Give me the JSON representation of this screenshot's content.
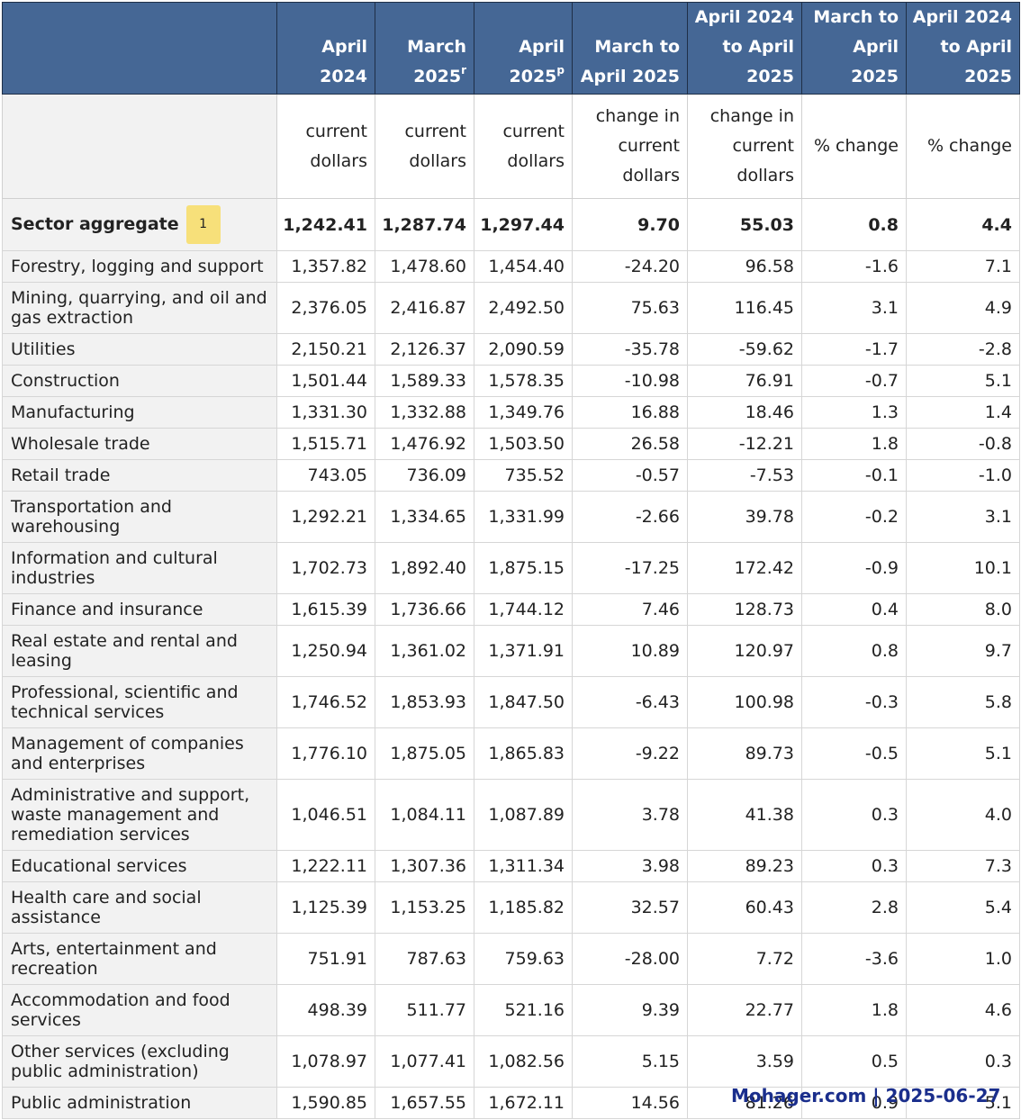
{
  "header": {
    "columns": [
      {
        "line1": "",
        "sup": ""
      },
      {
        "line1": "April 2024",
        "sup": ""
      },
      {
        "line1": "March 2025",
        "sup": "r"
      },
      {
        "line1": "April 2025",
        "sup": "p"
      },
      {
        "line1": "March to April 2025",
        "sup": ""
      },
      {
        "line1": "April 2024 to April 2025",
        "sup": ""
      },
      {
        "line1": "March to April 2025",
        "sup": ""
      },
      {
        "line1": "April 2024 to April 2025",
        "sup": ""
      }
    ],
    "units": [
      "",
      "current dollars",
      "current dollars",
      "current dollars",
      "change in current dollars",
      "change in current dollars",
      "% change",
      "% change"
    ]
  },
  "aggregate": {
    "label": "Sector aggregate",
    "note": "1",
    "values": [
      "1,242.41",
      "1,287.74",
      "1,297.44",
      "9.70",
      "55.03",
      "0.8",
      "4.4"
    ]
  },
  "rows": [
    {
      "label": "Forestry, logging and support",
      "values": [
        "1,357.82",
        "1,478.60",
        "1,454.40",
        "-24.20",
        "96.58",
        "-1.6",
        "7.1"
      ]
    },
    {
      "label": "Mining, quarrying, and oil and gas extraction",
      "values": [
        "2,376.05",
        "2,416.87",
        "2,492.50",
        "75.63",
        "116.45",
        "3.1",
        "4.9"
      ]
    },
    {
      "label": "Utilities",
      "values": [
        "2,150.21",
        "2,126.37",
        "2,090.59",
        "-35.78",
        "-59.62",
        "-1.7",
        "-2.8"
      ]
    },
    {
      "label": "Construction",
      "values": [
        "1,501.44",
        "1,589.33",
        "1,578.35",
        "-10.98",
        "76.91",
        "-0.7",
        "5.1"
      ]
    },
    {
      "label": "Manufacturing",
      "values": [
        "1,331.30",
        "1,332.88",
        "1,349.76",
        "16.88",
        "18.46",
        "1.3",
        "1.4"
      ]
    },
    {
      "label": "Wholesale trade",
      "values": [
        "1,515.71",
        "1,476.92",
        "1,503.50",
        "26.58",
        "-12.21",
        "1.8",
        "-0.8"
      ]
    },
    {
      "label": "Retail trade",
      "values": [
        "743.05",
        "736.09",
        "735.52",
        "-0.57",
        "-7.53",
        "-0.1",
        "-1.0"
      ]
    },
    {
      "label": "Transportation and warehousing",
      "values": [
        "1,292.21",
        "1,334.65",
        "1,331.99",
        "-2.66",
        "39.78",
        "-0.2",
        "3.1"
      ]
    },
    {
      "label": "Information and cultural industries",
      "values": [
        "1,702.73",
        "1,892.40",
        "1,875.15",
        "-17.25",
        "172.42",
        "-0.9",
        "10.1"
      ]
    },
    {
      "label": "Finance and insurance",
      "values": [
        "1,615.39",
        "1,736.66",
        "1,744.12",
        "7.46",
        "128.73",
        "0.4",
        "8.0"
      ]
    },
    {
      "label": "Real estate and rental and leasing",
      "values": [
        "1,250.94",
        "1,361.02",
        "1,371.91",
        "10.89",
        "120.97",
        "0.8",
        "9.7"
      ]
    },
    {
      "label": "Professional, scientific and technical services",
      "values": [
        "1,746.52",
        "1,853.93",
        "1,847.50",
        "-6.43",
        "100.98",
        "-0.3",
        "5.8"
      ]
    },
    {
      "label": "Management of companies and enterprises",
      "values": [
        "1,776.10",
        "1,875.05",
        "1,865.83",
        "-9.22",
        "89.73",
        "-0.5",
        "5.1"
      ]
    },
    {
      "label": "Administrative and support, waste management and remediation services",
      "values": [
        "1,046.51",
        "1,084.11",
        "1,087.89",
        "3.78",
        "41.38",
        "0.3",
        "4.0"
      ]
    },
    {
      "label": "Educational services",
      "values": [
        "1,222.11",
        "1,307.36",
        "1,311.34",
        "3.98",
        "89.23",
        "0.3",
        "7.3"
      ]
    },
    {
      "label": "Health care and social assistance",
      "values": [
        "1,125.39",
        "1,153.25",
        "1,185.82",
        "32.57",
        "60.43",
        "2.8",
        "5.4"
      ]
    },
    {
      "label": "Arts, entertainment and recreation",
      "values": [
        "751.91",
        "787.63",
        "759.63",
        "-28.00",
        "7.72",
        "-3.6",
        "1.0"
      ]
    },
    {
      "label": "Accommodation and food services",
      "values": [
        "498.39",
        "511.77",
        "521.16",
        "9.39",
        "22.77",
        "1.8",
        "4.6"
      ]
    },
    {
      "label": "Other services (excluding public administration)",
      "values": [
        "1,078.97",
        "1,077.41",
        "1,082.56",
        "5.15",
        "3.59",
        "0.5",
        "0.3"
      ]
    },
    {
      "label": "Public administration",
      "values": [
        "1,590.85",
        "1,657.55",
        "1,672.11",
        "14.56",
        "81.26",
        "0.9",
        "5.1"
      ]
    }
  ],
  "watermark": "Mohager.com | 2025-06-27",
  "colors": {
    "header_bg": "#456795",
    "stub_bg": "#f2f2f2",
    "note_badge": "#f7e07a",
    "watermark": "#1a2e8c"
  }
}
